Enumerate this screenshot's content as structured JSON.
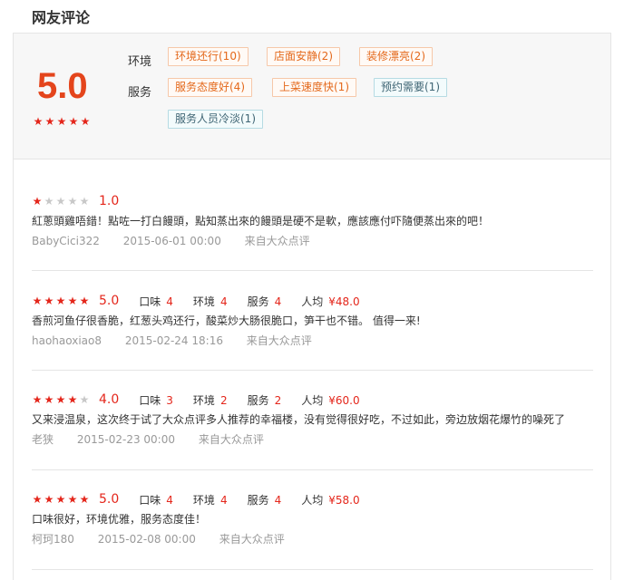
{
  "section_title": "网友评论",
  "summary": {
    "score": "5.0",
    "stars": 5,
    "groups": [
      {
        "label": "环境",
        "tags": [
          {
            "text": "环境还行(10)",
            "type": "pos"
          },
          {
            "text": "店面安静(2)",
            "type": "pos"
          },
          {
            "text": "装修漂亮(2)",
            "type": "pos"
          }
        ]
      },
      {
        "label": "服务",
        "tags": [
          {
            "text": "服务态度好(4)",
            "type": "pos"
          },
          {
            "text": "上菜速度快(1)",
            "type": "pos"
          },
          {
            "text": "预约需要(1)",
            "type": "neg"
          },
          {
            "text": "服务人员冷淡(1)",
            "type": "neg"
          }
        ]
      }
    ]
  },
  "reviews": [
    {
      "stars": 1,
      "score": "1.0",
      "details": [],
      "content": "紅蔥頭雞唔錯！點咗一打白饅頭，點知蒸出來的饅頭是硬不是軟，應該應付吓隨便蒸出來的吧！",
      "user": "BabyCici322",
      "time": "2015-06-01 00:00",
      "source": "来自大众点评"
    },
    {
      "stars": 5,
      "score": "5.0",
      "details": [
        {
          "label": "口味",
          "value": "4"
        },
        {
          "label": "环境",
          "value": "4"
        },
        {
          "label": "服务",
          "value": "4"
        },
        {
          "label": "人均",
          "value": "¥48.0"
        }
      ],
      "content": "香煎河鱼仔很香脆，红葱头鸡还行，酸菜炒大肠很脆口，笋干也不错。 值得一来!",
      "user": "haohaoxiao8",
      "time": "2015-02-24 18:16",
      "source": "来自大众点评"
    },
    {
      "stars": 4,
      "score": "4.0",
      "details": [
        {
          "label": "口味",
          "value": "3"
        },
        {
          "label": "环境",
          "value": "2"
        },
        {
          "label": "服务",
          "value": "2"
        },
        {
          "label": "人均",
          "value": "¥60.0"
        }
      ],
      "content": "又来浸温泉，这次终于试了大众点评多人推荐的幸福楼，没有觉得很好吃，不过如此，旁边放烟花爆竹的噪死了",
      "user": "老狭",
      "time": "2015-02-23 00:00",
      "source": "来自大众点评"
    },
    {
      "stars": 5,
      "score": "5.0",
      "details": [
        {
          "label": "口味",
          "value": "4"
        },
        {
          "label": "环境",
          "value": "4"
        },
        {
          "label": "服务",
          "value": "4"
        },
        {
          "label": "人均",
          "value": "¥58.0"
        }
      ],
      "content": "口味很好，环境优雅，服务态度佳！",
      "user": "柯珂180",
      "time": "2015-02-08 00:00",
      "source": "来自大众点评"
    }
  ],
  "colors": {
    "accent": "#e4261b",
    "score": "#e4451c",
    "star_off": "#c8c8c8",
    "tag_pos": "#e4691c",
    "tag_neg": "#3f6574"
  }
}
